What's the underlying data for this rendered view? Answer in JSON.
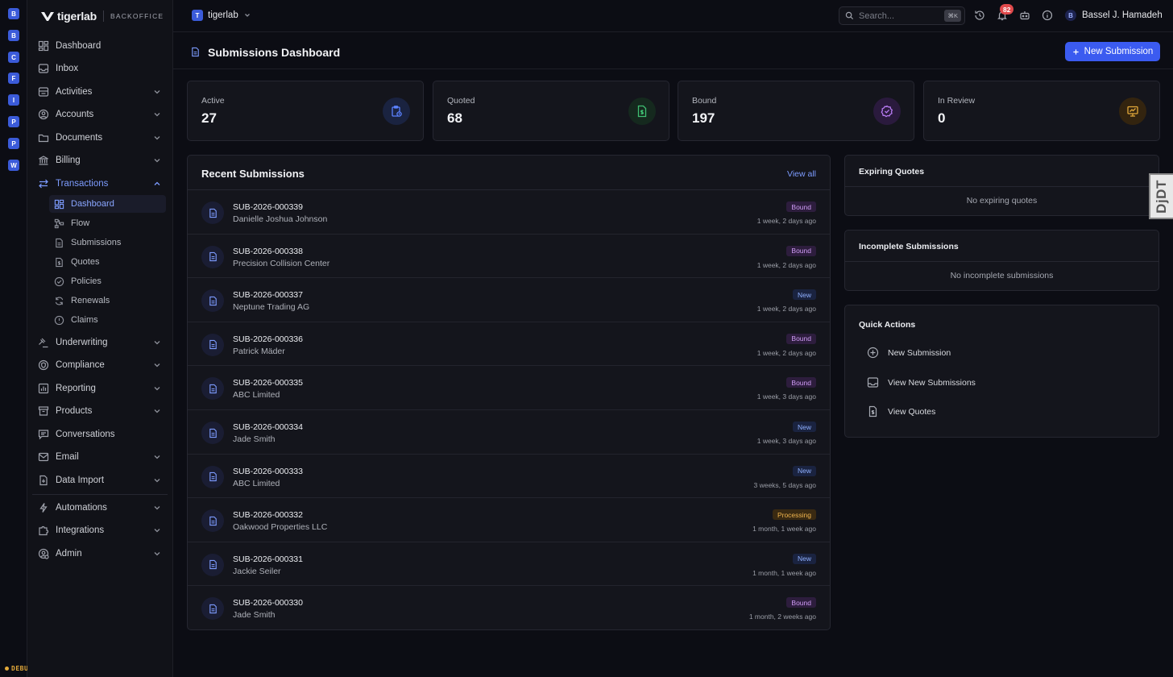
{
  "rail": {
    "items": [
      "B",
      "B",
      "C",
      "F",
      "I",
      "P",
      "P",
      "W"
    ],
    "debug_label": "DEBUG"
  },
  "brand": {
    "name": "tigerlab",
    "sub": "BACKOFFICE"
  },
  "sidebar": {
    "items": [
      {
        "label": "Dashboard",
        "icon": "dashboard-icon"
      },
      {
        "label": "Inbox",
        "icon": "inbox-icon"
      },
      {
        "label": "Activities",
        "icon": "activities-icon"
      },
      {
        "label": "Accounts",
        "icon": "accounts-icon"
      },
      {
        "label": "Documents",
        "icon": "folder-icon"
      },
      {
        "label": "Billing",
        "icon": "bank-icon"
      },
      {
        "label": "Transactions",
        "icon": "transactions-icon"
      },
      {
        "label": "Underwriting",
        "icon": "gavel-icon"
      },
      {
        "label": "Compliance",
        "icon": "shield-icon"
      },
      {
        "label": "Reporting",
        "icon": "chart-icon"
      },
      {
        "label": "Products",
        "icon": "box-icon"
      },
      {
        "label": "Conversations",
        "icon": "chat-icon"
      },
      {
        "label": "Email",
        "icon": "mail-icon"
      },
      {
        "label": "Data Import",
        "icon": "file-import-icon"
      },
      {
        "label": "Automations",
        "icon": "bolt-icon"
      },
      {
        "label": "Integrations",
        "icon": "puzzle-icon"
      },
      {
        "label": "Admin",
        "icon": "admin-icon"
      }
    ],
    "transactions_sub": [
      {
        "label": "Dashboard",
        "icon": "dashboard-icon"
      },
      {
        "label": "Flow",
        "icon": "flow-icon"
      },
      {
        "label": "Submissions",
        "icon": "document-icon"
      },
      {
        "label": "Quotes",
        "icon": "quote-icon"
      },
      {
        "label": "Policies",
        "icon": "check-badge-icon"
      },
      {
        "label": "Renewals",
        "icon": "refresh-icon"
      },
      {
        "label": "Claims",
        "icon": "alert-circle-icon"
      }
    ]
  },
  "topbar": {
    "tenant_initial": "T",
    "tenant_name": "tigerlab",
    "search_placeholder": "Search...",
    "search_shortcut": "⌘K",
    "notification_count": "82",
    "user_initial": "B",
    "user_name": "Bassel J. Hamadeh"
  },
  "page": {
    "title": "Submissions Dashboard",
    "new_button": "New Submission"
  },
  "stats": [
    {
      "label": "Active",
      "value": "27",
      "color": "#5b82ff",
      "bg": "#1a2340"
    },
    {
      "label": "Quoted",
      "value": "68",
      "color": "#3fbf72",
      "bg": "#15291e"
    },
    {
      "label": "Bound",
      "value": "197",
      "color": "#b77bf2",
      "bg": "#2a1a3d"
    },
    {
      "label": "In Review",
      "value": "0",
      "color": "#e3a93a",
      "bg": "#33240f"
    }
  ],
  "recent": {
    "title": "Recent Submissions",
    "view_all": "View all",
    "rows": [
      {
        "id": "SUB-2026-000339",
        "name": "Danielle Joshua Johnson",
        "status": "Bound",
        "time": "1 week, 2 days ago"
      },
      {
        "id": "SUB-2026-000338",
        "name": "Precision Collision Center",
        "status": "Bound",
        "time": "1 week, 2 days ago"
      },
      {
        "id": "SUB-2026-000337",
        "name": "Neptune Trading AG",
        "status": "New",
        "time": "1 week, 2 days ago"
      },
      {
        "id": "SUB-2026-000336",
        "name": "Patrick Mäder",
        "status": "Bound",
        "time": "1 week, 2 days ago"
      },
      {
        "id": "SUB-2026-000335",
        "name": "ABC Limited",
        "status": "Bound",
        "time": "1 week, 3 days ago"
      },
      {
        "id": "SUB-2026-000334",
        "name": "Jade Smith",
        "status": "New",
        "time": "1 week, 3 days ago"
      },
      {
        "id": "SUB-2026-000333",
        "name": "ABC Limited",
        "status": "New",
        "time": "3 weeks, 5 days ago"
      },
      {
        "id": "SUB-2026-000332",
        "name": "Oakwood Properties LLC",
        "status": "Processing",
        "time": "1 month, 1 week ago"
      },
      {
        "id": "SUB-2026-000331",
        "name": "Jackie Seiler",
        "status": "New",
        "time": "1 month, 1 week ago"
      },
      {
        "id": "SUB-2026-000330",
        "name": "Jade Smith",
        "status": "Bound",
        "time": "1 month, 2 weeks ago"
      }
    ]
  },
  "expiring": {
    "title": "Expiring Quotes",
    "empty": "No expiring quotes"
  },
  "incomplete": {
    "title": "Incomplete Submissions",
    "empty": "No incomplete submissions"
  },
  "quick": {
    "title": "Quick Actions",
    "items": [
      {
        "label": "New Submission",
        "icon": "plus-circle-icon"
      },
      {
        "label": "View New Submissions",
        "icon": "inbox-icon"
      },
      {
        "label": "View Quotes",
        "icon": "quote-icon"
      }
    ]
  },
  "djdt": "DjDT"
}
